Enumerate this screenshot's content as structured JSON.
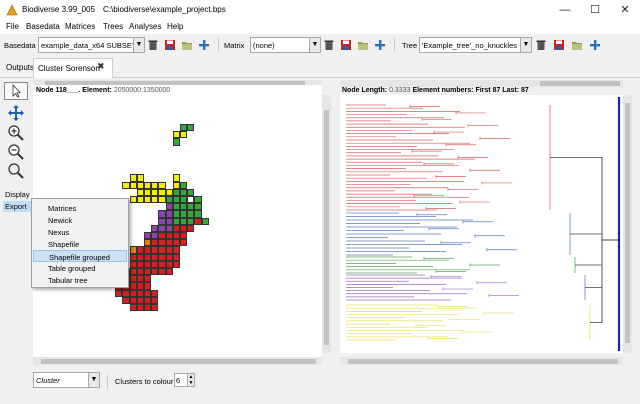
{
  "window": {
    "app_title": "Biodiverse 3.99_005",
    "doc_title": "C:\\biodiverse\\example_project.bps",
    "minimize": "—",
    "maximize": "☐",
    "close": "✕"
  },
  "menu": [
    "File",
    "Basedata",
    "Matrices",
    "Trees",
    "Analyses",
    "Help"
  ],
  "toolbar": {
    "basedata_label": "Basedata",
    "basedata_value": "example_data_x64 SUBSET",
    "matrix_label": "Matrix",
    "matrix_value": "(none)",
    "tree_label": "Tree",
    "tree_value": "'Example_tree'_no_knuckles"
  },
  "tabs": {
    "outputs": "Outputs",
    "active": "Cluster Sorenson"
  },
  "left_panel": {
    "node": "Node 118___",
    "element_label": ". Element:",
    "element_value": "2050000:1350000",
    "display": "Display",
    "export": "Export"
  },
  "right_panel": {
    "node_length_label": "Node Length:",
    "node_length_value": "0.3333",
    "element_numbers": "Element numbers: First 87 Last: 87"
  },
  "export_menu": [
    "Matrices",
    "Newick",
    "Nexus",
    "Shapefile",
    "Shapefile grouped",
    "Table grouped",
    "Tabular tree"
  ],
  "export_highlight": "Shapefile grouped",
  "bottom": {
    "colour_by": "Cluster",
    "clusters_label": "Clusters to colour",
    "clusters_value": "6"
  },
  "icons": [
    "select-arrow-icon",
    "pan-icon",
    "zoom-in-icon",
    "zoom-out-icon",
    "zoom-fit-icon",
    "trash-icon",
    "save-icon",
    "folder-icon",
    "add-icon"
  ],
  "colors": {
    "red": "#d81e1e",
    "yellow": "#f5f000",
    "green": "#35a83a",
    "purple": "#8e44ad",
    "orange": "#f07b12",
    "blue": "#2d6fba",
    "accent_line": "#1f1fcc"
  }
}
